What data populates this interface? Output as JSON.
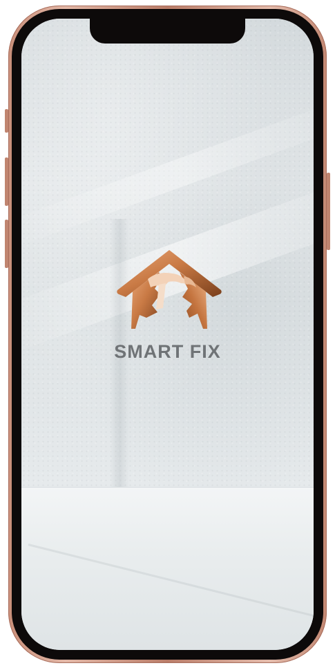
{
  "app": {
    "brand_name": "SMART FIX",
    "logo_icon": "house-hammer-icon"
  },
  "colors": {
    "brand_copper_light": "#e8a677",
    "brand_copper": "#c97a45",
    "brand_copper_dark": "#7a3f1c",
    "brand_text": "#6f7376",
    "device_frame": "#c98f7a"
  }
}
